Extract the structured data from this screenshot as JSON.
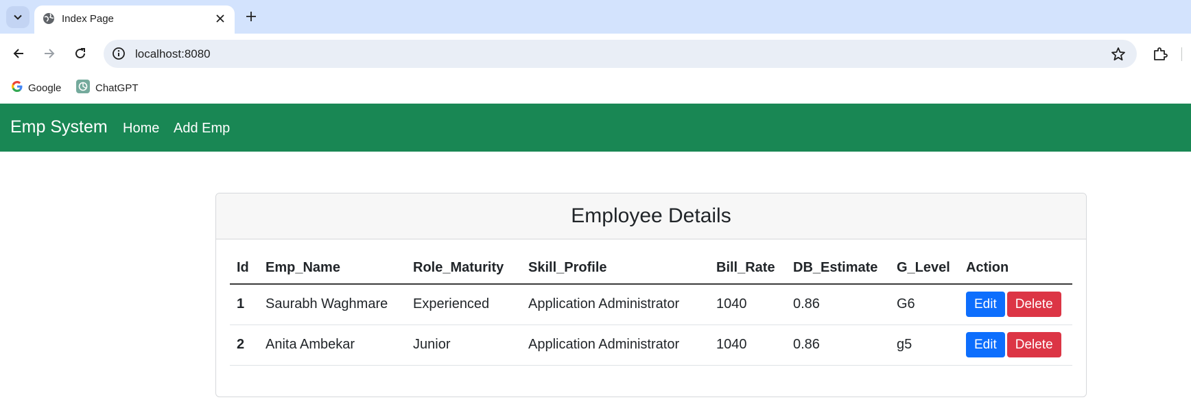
{
  "browser": {
    "tab": {
      "title": "Index Page"
    },
    "url": "localhost:8080",
    "bookmarks": [
      "Google",
      "ChatGPT"
    ]
  },
  "navbar": {
    "brand": "Emp System",
    "links": [
      "Home",
      "Add Emp"
    ],
    "bg_color": "#198754"
  },
  "card": {
    "title": "Employee Details"
  },
  "table": {
    "headers": [
      "Id",
      "Emp_Name",
      "Role_Maturity",
      "Skill_Profile",
      "Bill_Rate",
      "DB_Estimate",
      "G_Level",
      "Action"
    ],
    "rows": [
      {
        "id": "1",
        "name": "Saurabh Waghmare",
        "role": "Experienced",
        "skill": "Application Administrator",
        "bill": "1040",
        "db": "0.86",
        "glevel": "G6"
      },
      {
        "id": "2",
        "name": "Anita Ambekar",
        "role": "Junior",
        "skill": "Application Administrator",
        "bill": "1040",
        "db": "0.86",
        "glevel": "g5"
      }
    ],
    "edit_label": "Edit",
    "delete_label": "Delete"
  },
  "colors": {
    "edit": "#0d6efd",
    "delete": "#dc3545"
  },
  "icons": [
    "tab-search-icon",
    "globe-icon",
    "close-icon",
    "plus-icon",
    "back-icon",
    "forward-icon",
    "reload-icon",
    "info-icon",
    "star-icon",
    "extensions-icon",
    "google-icon",
    "chatgpt-icon"
  ]
}
